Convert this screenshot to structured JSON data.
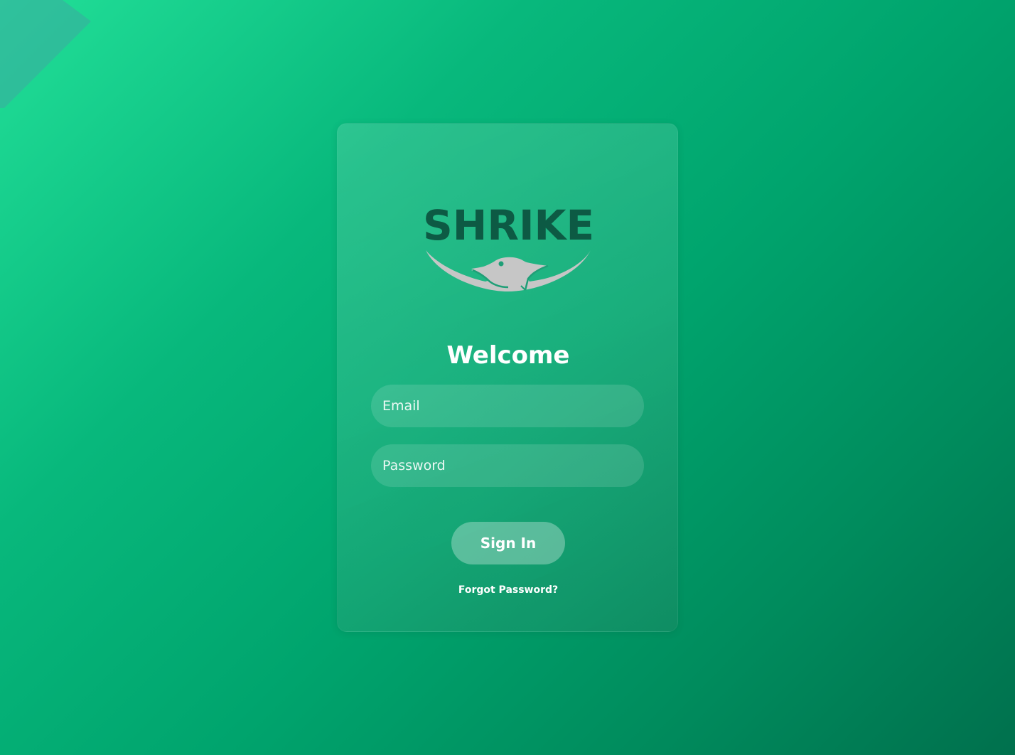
{
  "brand": {
    "logo_text": "SHRIKE",
    "logo_color": "#0d5a44",
    "bird_color": "#c4c4c4",
    "icon": "shrike-bird-icon"
  },
  "login": {
    "title": "Welcome",
    "email_placeholder": "Email",
    "password_placeholder": "Password",
    "signin_label": "Sign In",
    "forgot_label": "Forgot Password?"
  },
  "colors": {
    "background_light": "#22df98",
    "background_dark": "#00704d",
    "text": "#ffffff"
  }
}
